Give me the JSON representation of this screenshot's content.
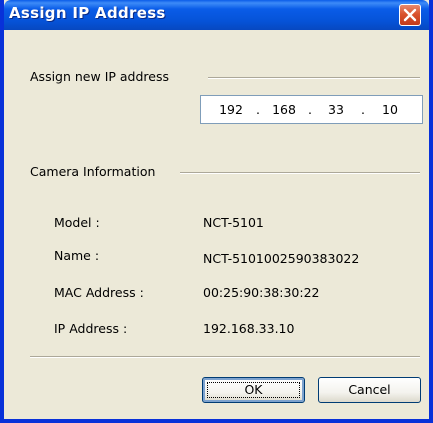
{
  "window": {
    "title": "Assign IP Address",
    "accent_color": "#0831d9"
  },
  "assign": {
    "group_label": "Assign new IP address",
    "ip": [
      "192",
      "168",
      "33",
      "10"
    ],
    "separator": "."
  },
  "camera": {
    "group_label": "Camera Information",
    "rows": [
      {
        "label": "Model :",
        "value": "NCT-5101"
      },
      {
        "label": "Name :",
        "value": "NCT-5101002590383022"
      },
      {
        "label": "MAC Address :",
        "value": "00:25:90:38:30:22"
      },
      {
        "label": "IP Address :",
        "value": "192.168.33.10"
      }
    ]
  },
  "buttons": {
    "ok_label": "OK",
    "cancel_label": "Cancel"
  },
  "icons": {
    "close": "close-icon"
  }
}
